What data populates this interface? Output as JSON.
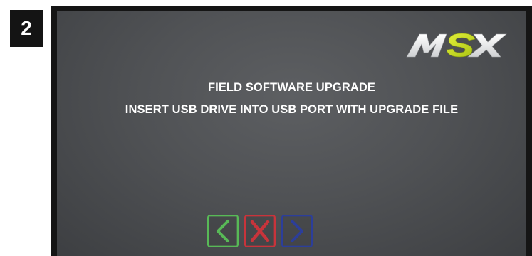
{
  "step": {
    "number": "2"
  },
  "screen": {
    "logo": {
      "text": "MSX",
      "icon": "msx-logo",
      "colors": {
        "letters": "#ffffff",
        "accent": "#c9dc1e"
      }
    },
    "message": {
      "line1": "FIELD SOFTWARE UPGRADE",
      "line2": "INSERT USB DRIVE INTO USB PORT WITH UPGRADE FILE"
    },
    "buttons": [
      {
        "name": "back",
        "icon": "chevron-left-icon",
        "color": "#58b957"
      },
      {
        "name": "cancel",
        "icon": "x-icon",
        "color": "#c8343b"
      },
      {
        "name": "next",
        "icon": "chevron-right-icon",
        "color": "#2c3e9a"
      }
    ]
  }
}
